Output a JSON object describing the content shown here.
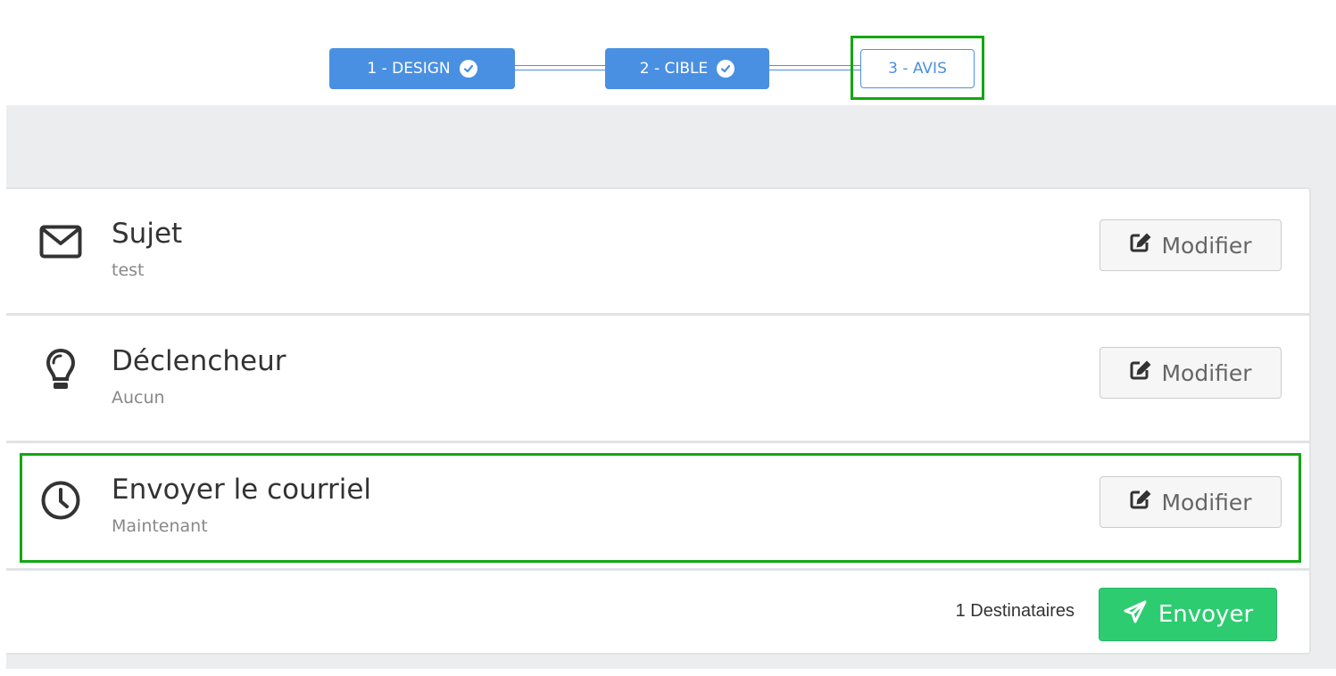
{
  "stepper": {
    "steps": [
      {
        "label": "1 - DESIGN",
        "status": "done"
      },
      {
        "label": "2 - CIBLE",
        "status": "done"
      },
      {
        "label": "3 - AVIS",
        "status": "current"
      }
    ]
  },
  "rows": [
    {
      "title": "Sujet",
      "value": "test",
      "icon": "envelope-icon",
      "button_label": "Modifier"
    },
    {
      "title": "Déclencheur",
      "value": "Aucun",
      "icon": "lightbulb-icon",
      "button_label": "Modifier"
    },
    {
      "title": "Envoyer le courriel",
      "value": "Maintenant",
      "icon": "clock-icon",
      "button_label": "Modifier"
    }
  ],
  "footer": {
    "recipients_text": "1 Destinataires",
    "send_label": "Envoyer"
  },
  "colors": {
    "primary": "#4a90e2",
    "success": "#2ecc71",
    "highlight": "#12a712"
  }
}
